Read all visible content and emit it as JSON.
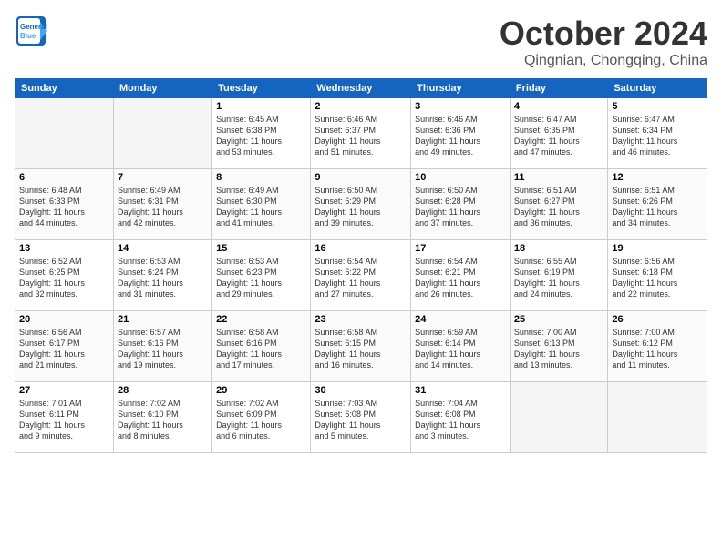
{
  "header": {
    "logo": {
      "line1": "General",
      "line2": "Blue"
    },
    "month_title": "October 2024",
    "subtitle": "Qingnian, Chongqing, China"
  },
  "weekdays": [
    "Sunday",
    "Monday",
    "Tuesday",
    "Wednesday",
    "Thursday",
    "Friday",
    "Saturday"
  ],
  "weeks": [
    [
      {
        "day": "",
        "info": ""
      },
      {
        "day": "",
        "info": ""
      },
      {
        "day": "1",
        "info": "Sunrise: 6:45 AM\nSunset: 6:38 PM\nDaylight: 11 hours\nand 53 minutes."
      },
      {
        "day": "2",
        "info": "Sunrise: 6:46 AM\nSunset: 6:37 PM\nDaylight: 11 hours\nand 51 minutes."
      },
      {
        "day": "3",
        "info": "Sunrise: 6:46 AM\nSunset: 6:36 PM\nDaylight: 11 hours\nand 49 minutes."
      },
      {
        "day": "4",
        "info": "Sunrise: 6:47 AM\nSunset: 6:35 PM\nDaylight: 11 hours\nand 47 minutes."
      },
      {
        "day": "5",
        "info": "Sunrise: 6:47 AM\nSunset: 6:34 PM\nDaylight: 11 hours\nand 46 minutes."
      }
    ],
    [
      {
        "day": "6",
        "info": "Sunrise: 6:48 AM\nSunset: 6:33 PM\nDaylight: 11 hours\nand 44 minutes."
      },
      {
        "day": "7",
        "info": "Sunrise: 6:49 AM\nSunset: 6:31 PM\nDaylight: 11 hours\nand 42 minutes."
      },
      {
        "day": "8",
        "info": "Sunrise: 6:49 AM\nSunset: 6:30 PM\nDaylight: 11 hours\nand 41 minutes."
      },
      {
        "day": "9",
        "info": "Sunrise: 6:50 AM\nSunset: 6:29 PM\nDaylight: 11 hours\nand 39 minutes."
      },
      {
        "day": "10",
        "info": "Sunrise: 6:50 AM\nSunset: 6:28 PM\nDaylight: 11 hours\nand 37 minutes."
      },
      {
        "day": "11",
        "info": "Sunrise: 6:51 AM\nSunset: 6:27 PM\nDaylight: 11 hours\nand 36 minutes."
      },
      {
        "day": "12",
        "info": "Sunrise: 6:51 AM\nSunset: 6:26 PM\nDaylight: 11 hours\nand 34 minutes."
      }
    ],
    [
      {
        "day": "13",
        "info": "Sunrise: 6:52 AM\nSunset: 6:25 PM\nDaylight: 11 hours\nand 32 minutes."
      },
      {
        "day": "14",
        "info": "Sunrise: 6:53 AM\nSunset: 6:24 PM\nDaylight: 11 hours\nand 31 minutes."
      },
      {
        "day": "15",
        "info": "Sunrise: 6:53 AM\nSunset: 6:23 PM\nDaylight: 11 hours\nand 29 minutes."
      },
      {
        "day": "16",
        "info": "Sunrise: 6:54 AM\nSunset: 6:22 PM\nDaylight: 11 hours\nand 27 minutes."
      },
      {
        "day": "17",
        "info": "Sunrise: 6:54 AM\nSunset: 6:21 PM\nDaylight: 11 hours\nand 26 minutes."
      },
      {
        "day": "18",
        "info": "Sunrise: 6:55 AM\nSunset: 6:19 PM\nDaylight: 11 hours\nand 24 minutes."
      },
      {
        "day": "19",
        "info": "Sunrise: 6:56 AM\nSunset: 6:18 PM\nDaylight: 11 hours\nand 22 minutes."
      }
    ],
    [
      {
        "day": "20",
        "info": "Sunrise: 6:56 AM\nSunset: 6:17 PM\nDaylight: 11 hours\nand 21 minutes."
      },
      {
        "day": "21",
        "info": "Sunrise: 6:57 AM\nSunset: 6:16 PM\nDaylight: 11 hours\nand 19 minutes."
      },
      {
        "day": "22",
        "info": "Sunrise: 6:58 AM\nSunset: 6:16 PM\nDaylight: 11 hours\nand 17 minutes."
      },
      {
        "day": "23",
        "info": "Sunrise: 6:58 AM\nSunset: 6:15 PM\nDaylight: 11 hours\nand 16 minutes."
      },
      {
        "day": "24",
        "info": "Sunrise: 6:59 AM\nSunset: 6:14 PM\nDaylight: 11 hours\nand 14 minutes."
      },
      {
        "day": "25",
        "info": "Sunrise: 7:00 AM\nSunset: 6:13 PM\nDaylight: 11 hours\nand 13 minutes."
      },
      {
        "day": "26",
        "info": "Sunrise: 7:00 AM\nSunset: 6:12 PM\nDaylight: 11 hours\nand 11 minutes."
      }
    ],
    [
      {
        "day": "27",
        "info": "Sunrise: 7:01 AM\nSunset: 6:11 PM\nDaylight: 11 hours\nand 9 minutes."
      },
      {
        "day": "28",
        "info": "Sunrise: 7:02 AM\nSunset: 6:10 PM\nDaylight: 11 hours\nand 8 minutes."
      },
      {
        "day": "29",
        "info": "Sunrise: 7:02 AM\nSunset: 6:09 PM\nDaylight: 11 hours\nand 6 minutes."
      },
      {
        "day": "30",
        "info": "Sunrise: 7:03 AM\nSunset: 6:08 PM\nDaylight: 11 hours\nand 5 minutes."
      },
      {
        "day": "31",
        "info": "Sunrise: 7:04 AM\nSunset: 6:08 PM\nDaylight: 11 hours\nand 3 minutes."
      },
      {
        "day": "",
        "info": ""
      },
      {
        "day": "",
        "info": ""
      }
    ]
  ]
}
